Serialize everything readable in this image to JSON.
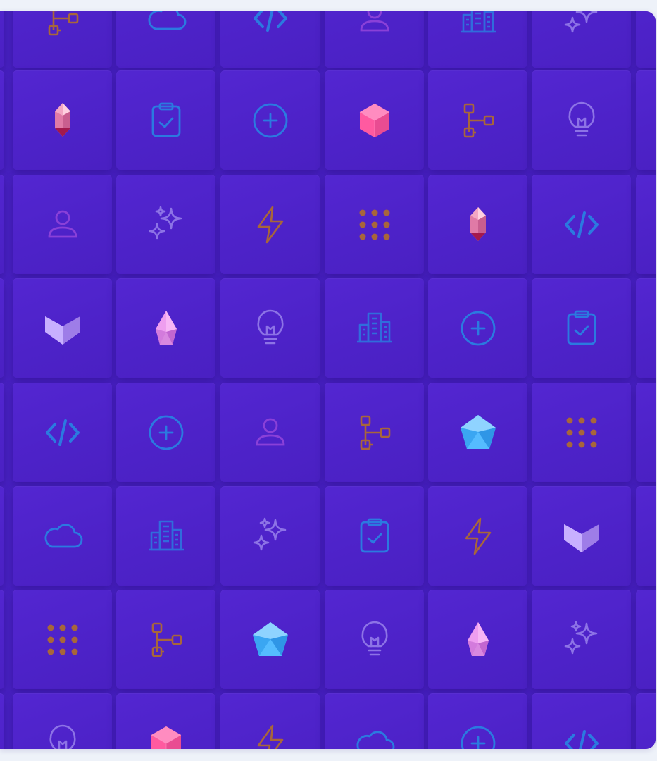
{
  "palette": {
    "background": "#eef2f9",
    "panel": "#4a22c4",
    "tile": "#5025cc",
    "blue": "#2b7ae0",
    "orange": "#a8663a",
    "purple": "#8a40d8",
    "lavender": "#8d73e6",
    "pink": "#ff5ca8",
    "cyan": "#3fb2ff"
  },
  "grid": {
    "rows": [
      [
        "flow-icon",
        "cloud-icon",
        "code-icon",
        "user-icon",
        "building-icon",
        "sparkles-icon"
      ],
      [
        "crystal-icon",
        "clipboard-check-icon",
        "plus-circle-icon",
        "pink-hexagon-icon",
        "flow-icon",
        "lightbulb-icon"
      ],
      [
        "user-icon",
        "sparkles-icon",
        "lightning-icon",
        "dots-grid-icon",
        "crystal-icon",
        "code-icon"
      ],
      [
        "chevron-icon",
        "gem-icon",
        "lightbulb-icon",
        "building-icon",
        "plus-circle-icon",
        "clipboard-check-icon"
      ],
      [
        "code-icon",
        "plus-circle-icon",
        "user-icon",
        "flow-icon",
        "pentagon-gem-icon",
        "dots-grid-icon"
      ],
      [
        "cloud-icon",
        "building-icon",
        "sparkles-icon",
        "clipboard-check-icon",
        "lightning-icon",
        "chevron-icon"
      ],
      [
        "dots-grid-icon",
        "flow-icon",
        "pentagon-gem-icon",
        "lightbulb-icon",
        "gem-icon",
        "sparkles-icon"
      ],
      [
        "lightbulb-icon",
        "pink-hexagon-icon",
        "lightning-icon",
        "cloud-icon",
        "plus-circle-icon",
        "code-icon"
      ]
    ]
  }
}
